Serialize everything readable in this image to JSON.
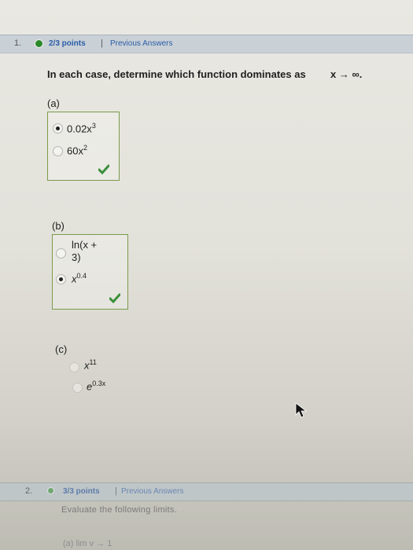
{
  "question1": {
    "number": "1.",
    "points": "2/3 points",
    "separator": "|",
    "previous_answers": "Previous Answers",
    "prompt": "In each case, determine which function dominates as",
    "prompt_math": "x → ∞.",
    "parts": [
      {
        "label": "(a)",
        "options": [
          {
            "base": "0.02x",
            "exp": "3",
            "selected": true
          },
          {
            "base": "60x",
            "exp": "2",
            "selected": false
          }
        ],
        "correct": true
      },
      {
        "label": "(b)",
        "options": [
          {
            "line1": "ln(x +",
            "line2": "3)",
            "selected": false
          },
          {
            "base": "x",
            "exp": "0.4",
            "selected": true
          }
        ],
        "correct": true
      },
      {
        "label": "(c)",
        "options": [
          {
            "base": "x",
            "exp": "11",
            "selected": false
          },
          {
            "base": "e",
            "exp": "0.3x",
            "selected": false
          }
        ]
      }
    ]
  },
  "question2": {
    "number": "2.",
    "points": "3/3 points",
    "separator": "|",
    "previous_answers": "Previous Answers",
    "prompt": "Evaluate the following limits.",
    "first_item": "(a)   lim   v  →   1"
  },
  "colors": {
    "accent_link": "#2a5da8",
    "correct_green": "#3a8f3a",
    "box_border": "#7c9a4a"
  }
}
